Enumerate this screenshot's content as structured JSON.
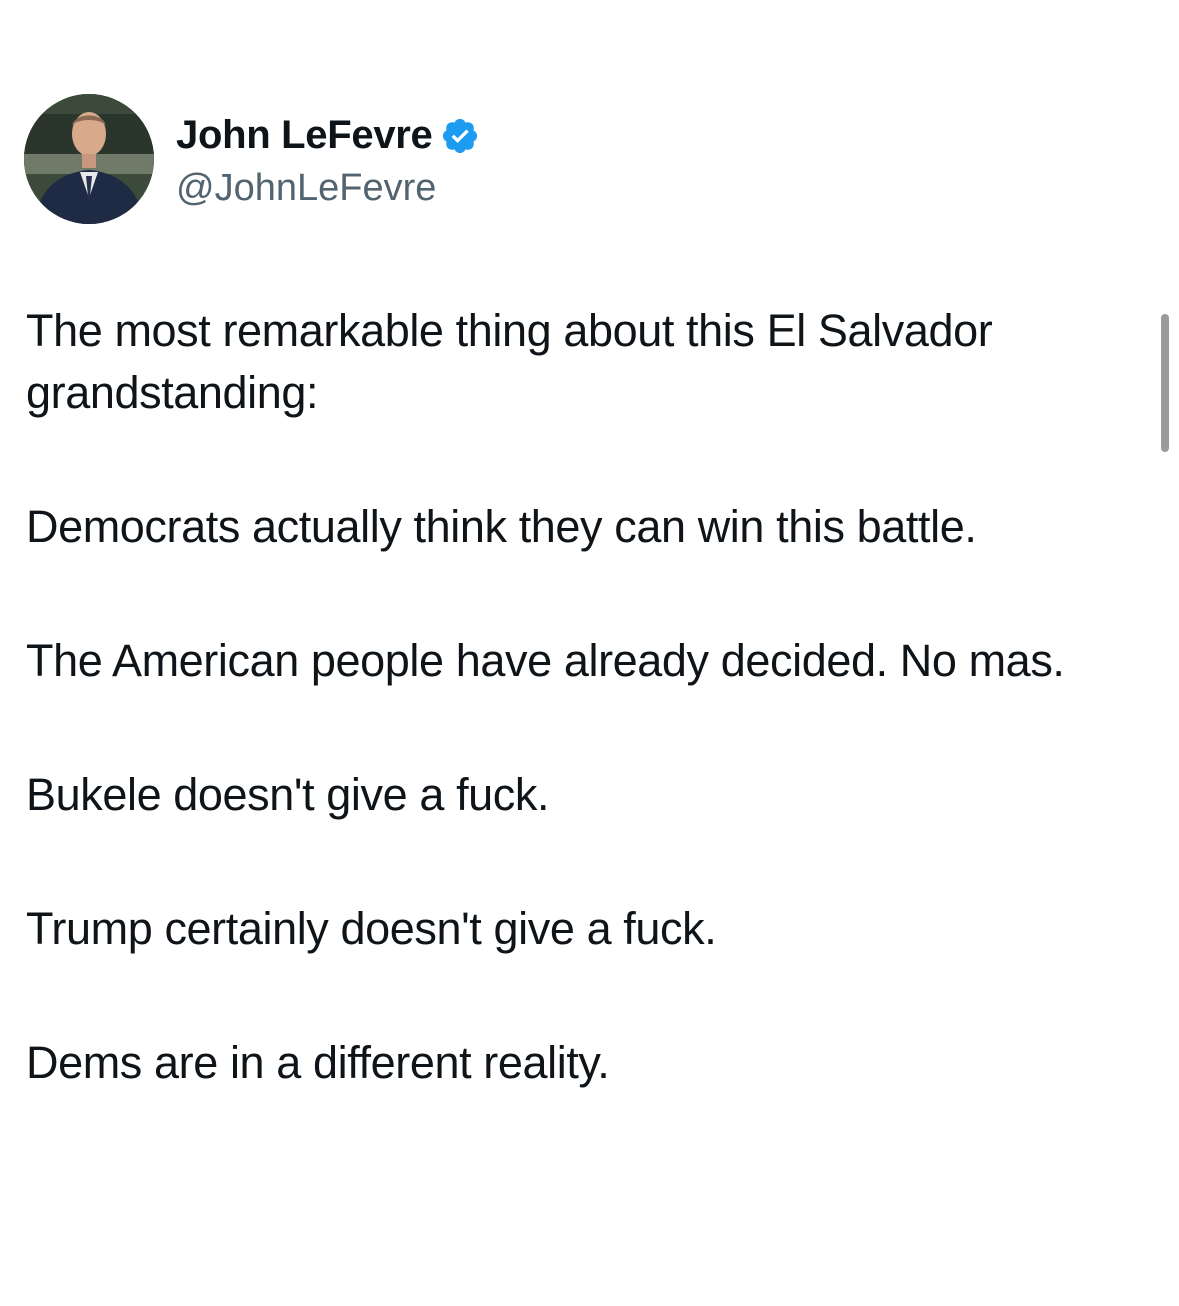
{
  "author": {
    "display_name": "John LeFevre",
    "handle": "@JohnLeFevre",
    "verified": true,
    "verified_color": "#1d9bf0",
    "avatar_icon": "profile-photo"
  },
  "post": {
    "paragraphs": [
      "The most remarkable thing about this El Salvador grandstanding:",
      "Democrats actually think they can win this battle.",
      "The American people have already decided. No mas.",
      "Bukele doesn't give a fuck.",
      "Trump certainly doesn't give a fuck.",
      "Dems are in a different reality."
    ]
  },
  "colors": {
    "text": "#0f1419",
    "secondary_text": "#536471",
    "background": "#ffffff"
  }
}
